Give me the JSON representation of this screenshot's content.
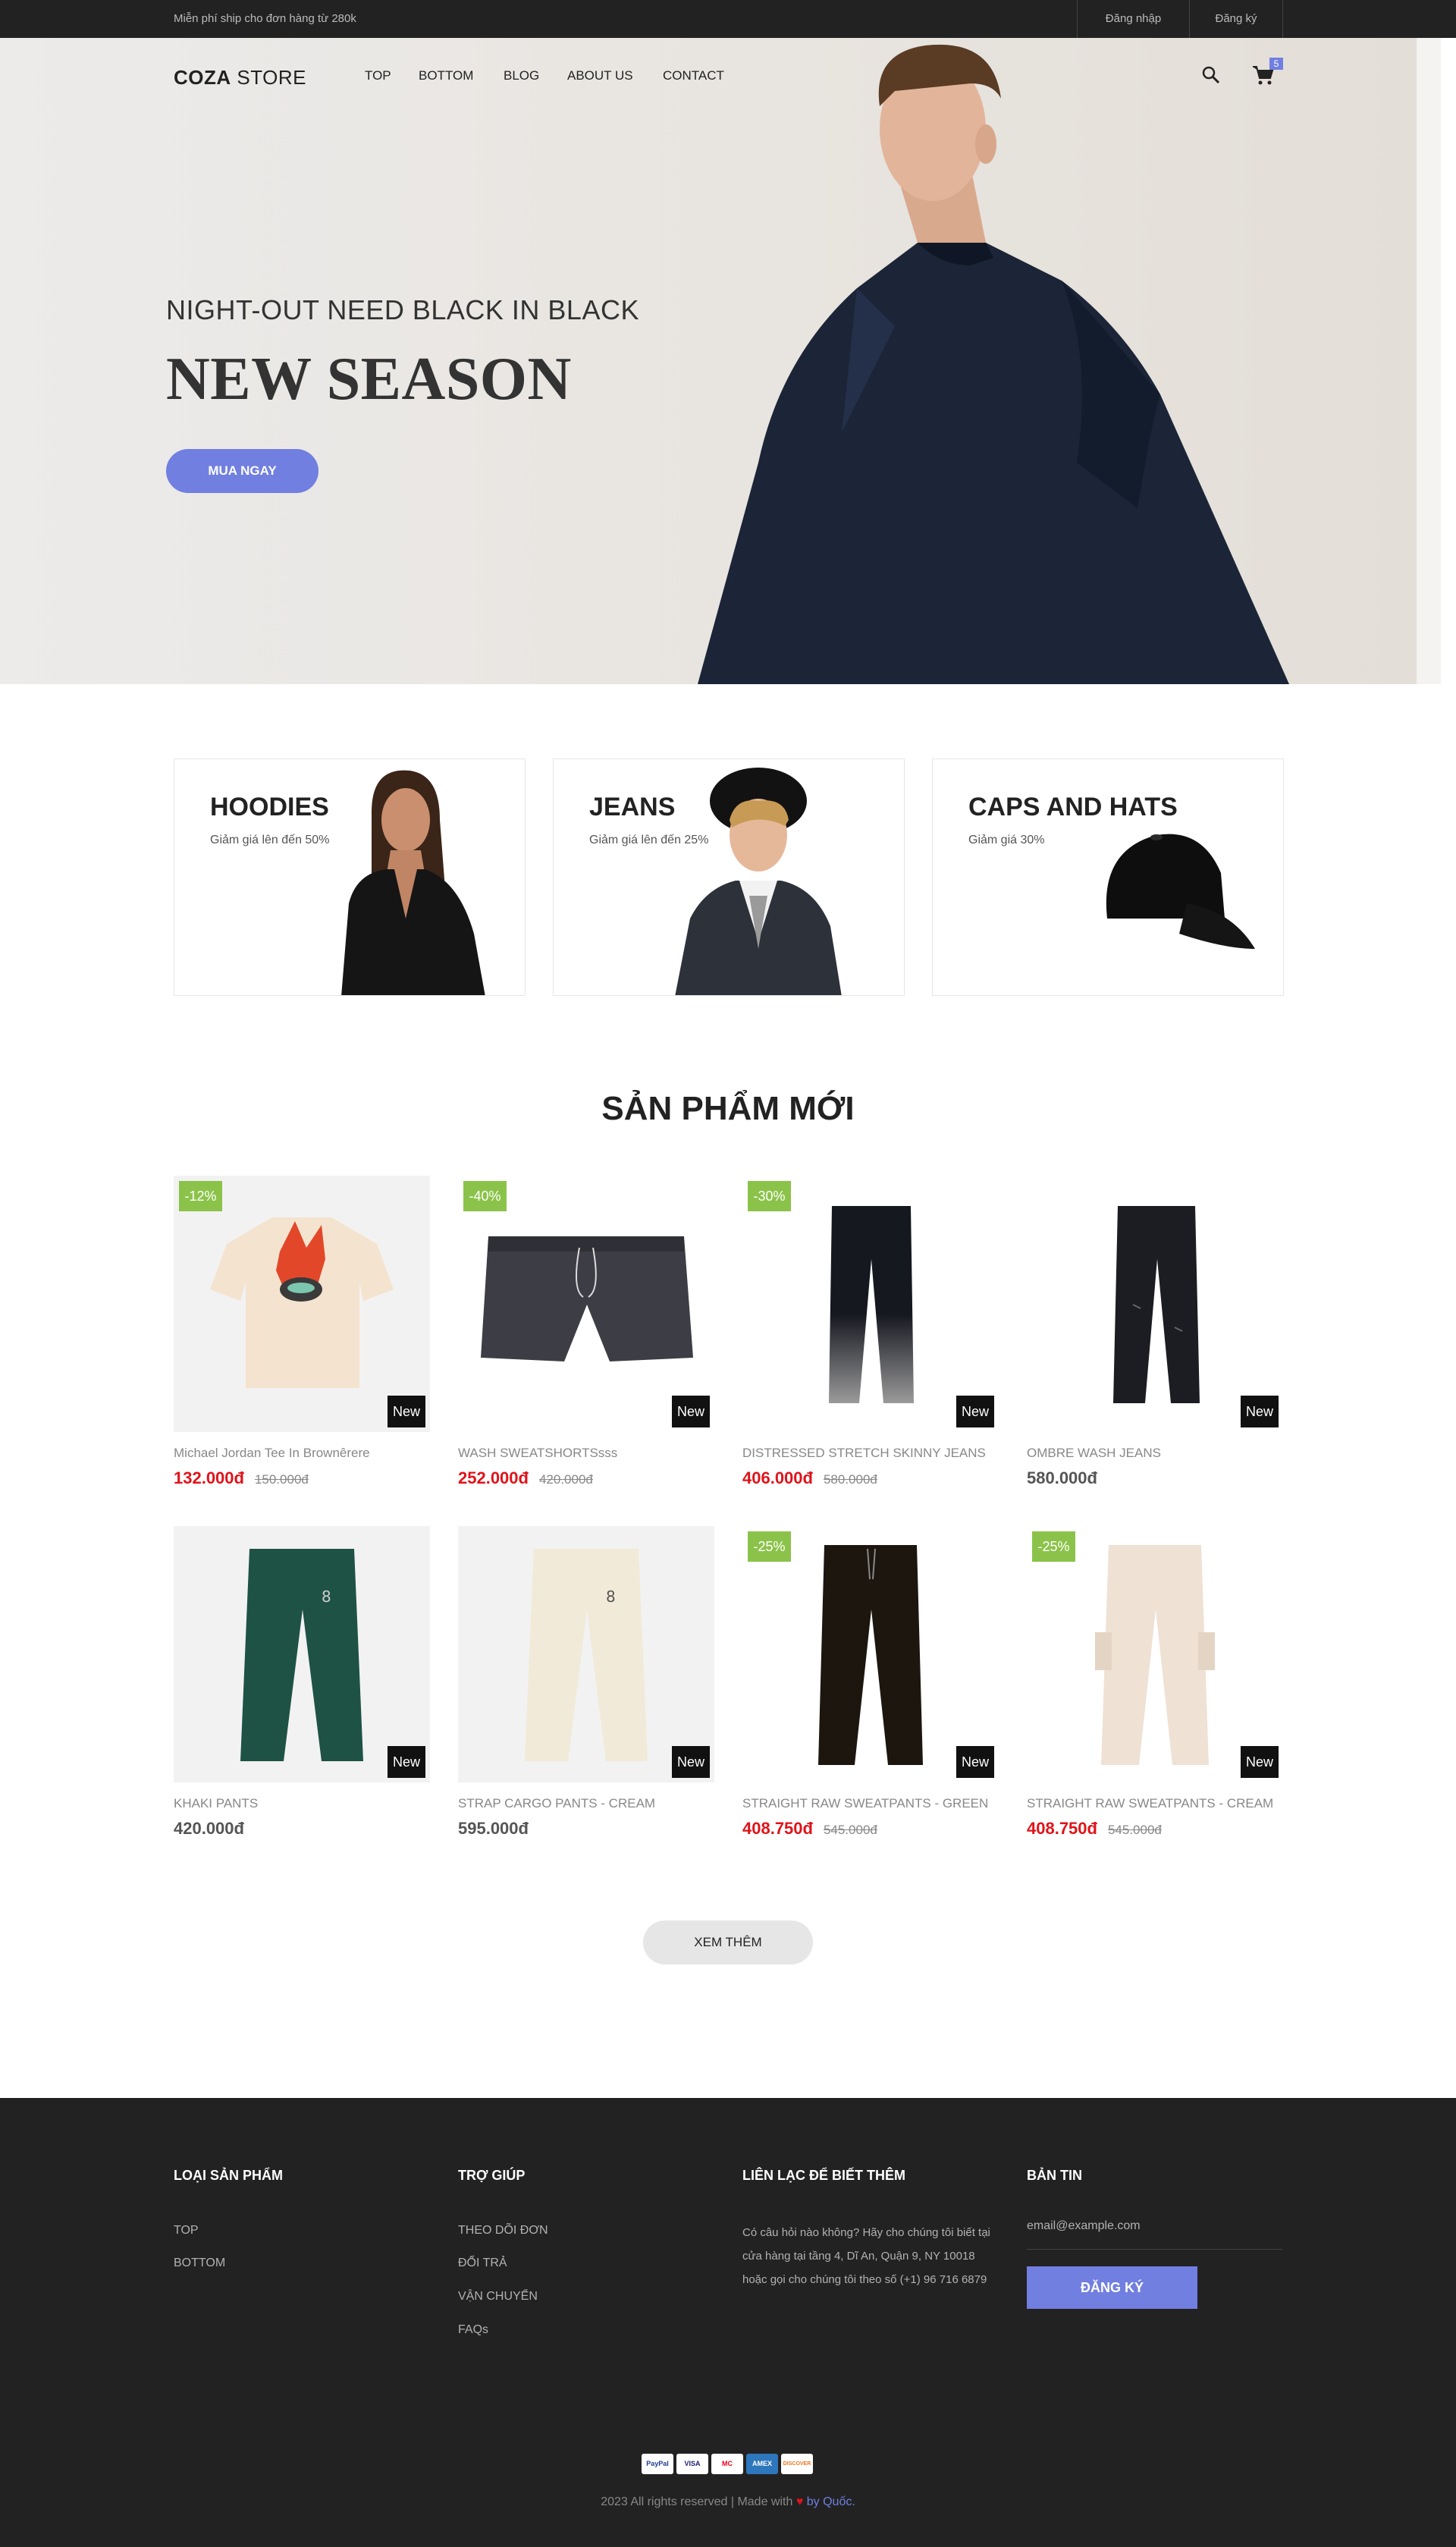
{
  "topbar": {
    "shipping_note": "Miễn phí ship cho đơn hàng từ 280k",
    "login": "Đăng nhập",
    "register": "Đăng ký"
  },
  "header": {
    "brand_bold": "COZA",
    "brand_rest": " STORE",
    "nav": [
      "TOP",
      "BOTTOM",
      "BLOG",
      "ABOUT US",
      "CONTACT"
    ],
    "cart_count": "5",
    "icons": [
      "search-icon",
      "cart-icon"
    ]
  },
  "hero": {
    "subtitle": "NIGHT-OUT NEED BLACK IN BLACK",
    "title": "NEW SEASON",
    "button": "MUA NGAY"
  },
  "categories": [
    {
      "title": "HOODIES",
      "subtitle": "Giảm giá lên đến 50%"
    },
    {
      "title": "JEANS",
      "subtitle": "Giảm giá lên đến 25%"
    },
    {
      "title": "CAPS AND HATS",
      "subtitle": "Giảm giá 30%"
    }
  ],
  "section_title": "SẢN PHẨM MỚI",
  "products": [
    {
      "name": "Michael Jordan Tee In Brownêrere",
      "price": "132.000đ",
      "old_price": "150.000đ",
      "discount": "-12%",
      "tag": "New"
    },
    {
      "name": "WASH SWEATSHORTSsss",
      "price": "252.000đ",
      "old_price": "420.000đ",
      "discount": "-40%",
      "tag": "New"
    },
    {
      "name": "DISTRESSED STRETCH SKINNY JEANS",
      "price": "406.000đ",
      "old_price": "580.000đ",
      "discount": "-30%",
      "tag": "New"
    },
    {
      "name": "OMBRE WASH JEANS",
      "price": "580.000đ",
      "old_price": "",
      "discount": "",
      "tag": "New"
    },
    {
      "name": "KHAKI PANTS",
      "price": "420.000đ",
      "old_price": "",
      "discount": "",
      "tag": "New"
    },
    {
      "name": "STRAP CARGO PANTS - CREAM",
      "price": "595.000đ",
      "old_price": "",
      "discount": "",
      "tag": "New"
    },
    {
      "name": "STRAIGHT RAW SWEATPANTS - GREEN",
      "price": "408.750đ",
      "old_price": "545.000đ",
      "discount": "-25%",
      "tag": "New"
    },
    {
      "name": "STRAIGHT RAW SWEATPANTS - CREAM",
      "price": "408.750đ",
      "old_price": "545.000đ",
      "discount": "-25%",
      "tag": "New"
    }
  ],
  "more_button": "XEM THÊM",
  "footer": {
    "col1_title": "LOẠI SẢN PHẨM",
    "col1_links": [
      "TOP",
      "BOTTOM"
    ],
    "col2_title": "TRỢ GIÚP",
    "col2_links": [
      "THEO DÕI ĐƠN",
      "ĐỔI TRẢ",
      "VẬN CHUYỂN",
      "FAQs"
    ],
    "col3_title": "LIÊN LẠC ĐỂ BIẾT THÊM",
    "col3_text": "Có câu hỏi nào không? Hãy cho chúng tôi biết tại cửa hàng tại tầng 4, Dĩ An, Quận 9, NY 10018 hoặc gọi cho chúng tôi theo số (+1) 96 716 6879",
    "col4_title": "BẢN TIN",
    "email_placeholder": "email@example.com",
    "subscribe": "ĐĂNG KÝ",
    "cards": [
      "PayPal",
      "VISA",
      "MC",
      "AMEX",
      "DISCOVER"
    ],
    "copyright": "2023 All rights reserved | Made with ",
    "author": "by Quốc."
  },
  "colors": {
    "accent": "#717fe0",
    "sale": "#e0131a",
    "badge": "#8bc34a",
    "dark": "#222222"
  }
}
